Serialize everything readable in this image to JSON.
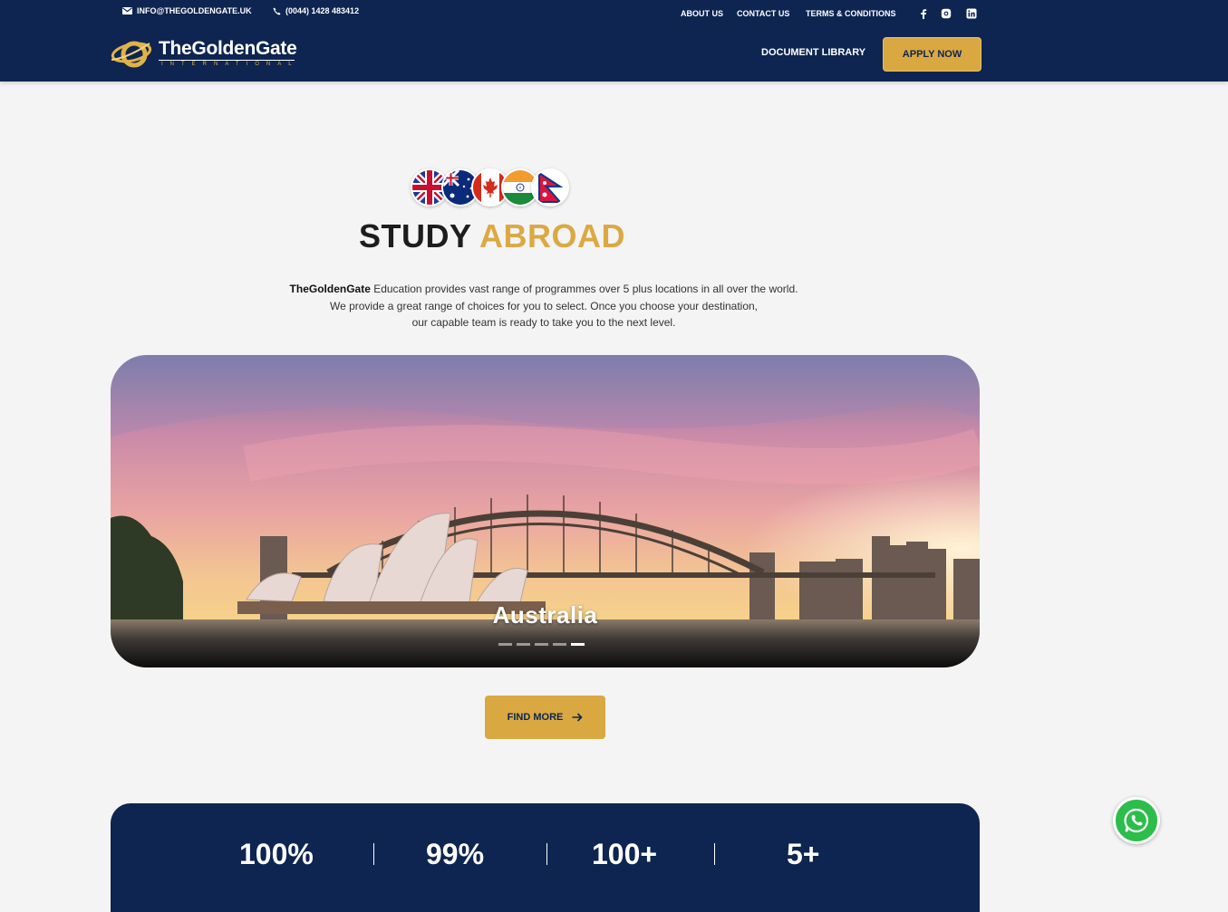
{
  "topbar": {
    "email": "INFO@THEGOLDENGATE.UK",
    "phone": "(0044) 1428 483412",
    "links": [
      "ABOUT US",
      "CONTACT US",
      "TERMS & CONDITIONS"
    ],
    "social_icons": [
      "facebook-icon",
      "instagram-icon",
      "linkedin-icon"
    ]
  },
  "header": {
    "brand": "TheGoldenGate",
    "brand_sub": "INTERNATIONAL",
    "doc_library": "DOCUMENT LIBRARY",
    "apply": "APPLY NOW"
  },
  "section": {
    "flags": [
      "uk-flag",
      "australia-flag",
      "canada-flag",
      "india-flag",
      "nepal-flag"
    ],
    "title_dark": "STUDY",
    "title_gold": "ABROAD",
    "intro_brand": "TheGoldenGate",
    "intro_line1": " Education provides vast range of programmes over 5 plus locations in all over the world.",
    "intro_line2": "We provide a great range of choices for you to select. Once you choose your destination,",
    "intro_line3": "our capable team is ready to take you to the next level."
  },
  "hero": {
    "label": "Australia",
    "slides": 5,
    "active_slide": 5
  },
  "find_more": "FIND MORE",
  "stats": [
    "100%",
    "99%",
    "100+",
    "5+"
  ],
  "colors": {
    "navy": "#0d2550",
    "gold": "#d9a841",
    "background": "#f4f4f4"
  }
}
